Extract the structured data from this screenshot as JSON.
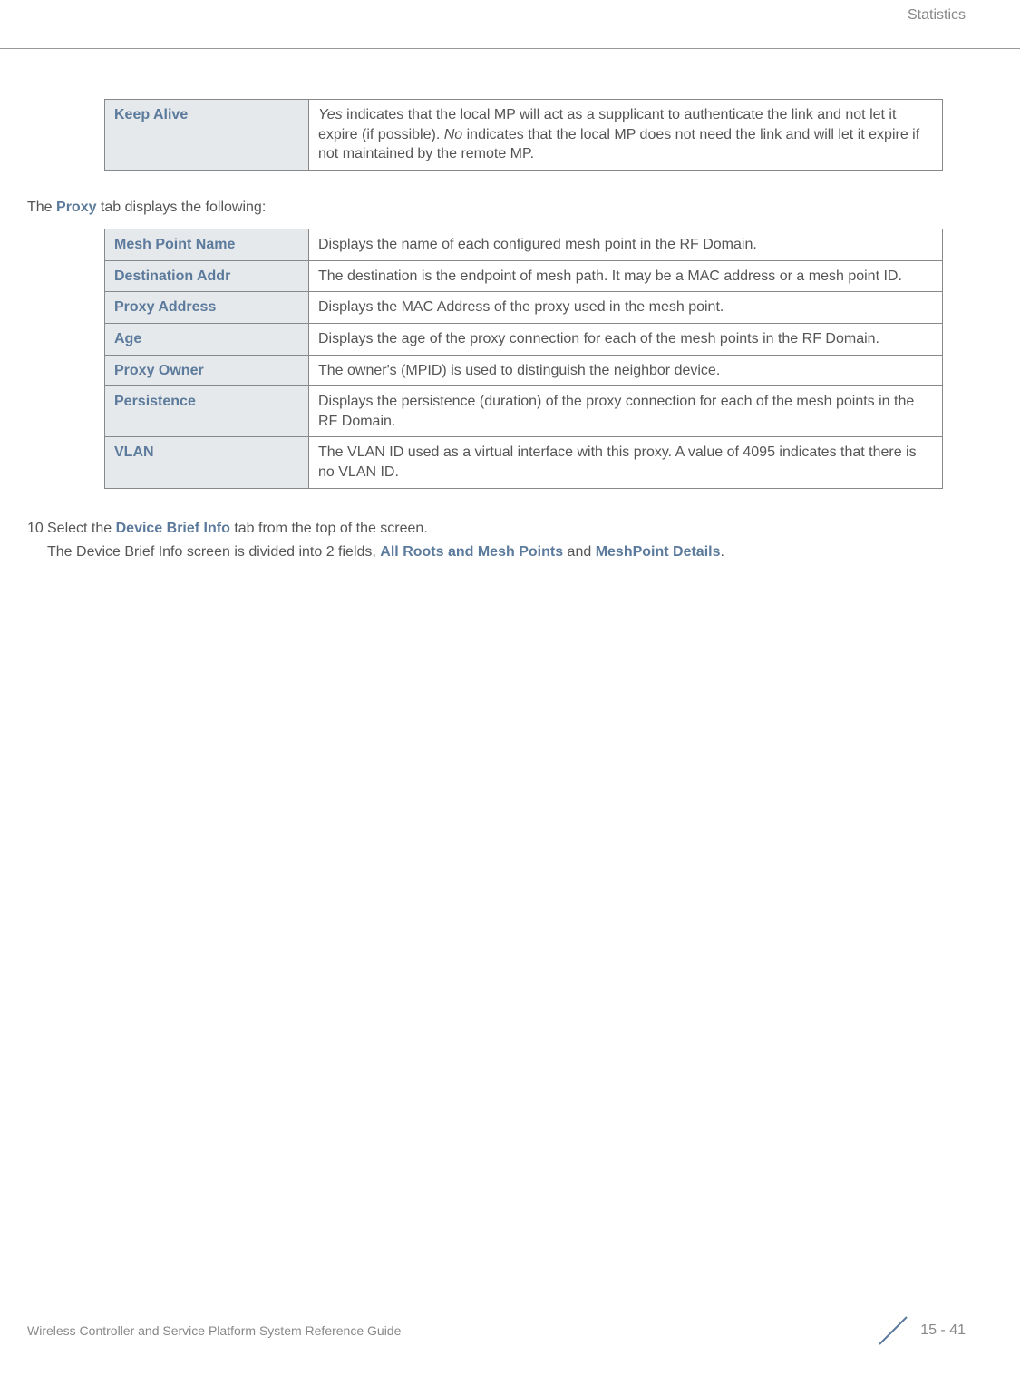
{
  "header": {
    "section": "Statistics"
  },
  "table1": {
    "rows": [
      {
        "label": "Keep Alive",
        "desc_prefix_italic": "Yes",
        "desc_part1": " indicates that the local MP will act as a supplicant to authenticate the link and not let it expire (if possible). ",
        "desc_mid_italic": "No",
        "desc_part2": " indicates that the local MP does not need the link and will let it expire if not maintained by the remote MP."
      }
    ]
  },
  "intro1": {
    "prefix": "The ",
    "bold": "Proxy",
    "suffix": " tab displays the following:"
  },
  "table2": {
    "rows": [
      {
        "label": "Mesh Point Name",
        "desc": "Displays the name of each configured mesh point in the RF Domain."
      },
      {
        "label": "Destination Addr",
        "desc": "The destination is the endpoint of mesh path. It may be a MAC address or a mesh point ID."
      },
      {
        "label": "Proxy Address",
        "desc": "Displays the MAC Address of the proxy used in the mesh point."
      },
      {
        "label": "Age",
        "desc": "Displays the age of the proxy connection for each of the mesh points in the RF Domain."
      },
      {
        "label": "Proxy Owner",
        "desc": "The owner's (MPID) is used to distinguish the neighbor device."
      },
      {
        "label": "Persistence",
        "desc": "Displays the persistence (duration) of the proxy connection for each of the mesh points in the RF Domain."
      },
      {
        "label": "VLAN",
        "desc": "The VLAN ID used as a virtual interface with this proxy. A value of 4095 indicates that there is no VLAN ID."
      }
    ]
  },
  "step": {
    "num": "10",
    "prefix": "Select the ",
    "bold": "Device Brief Info",
    "suffix": " tab from the top of the screen.",
    "line2_prefix": "The Device Brief Info screen is divided into 2 fields, ",
    "line2_bold1": "All Roots and Mesh Points",
    "line2_mid": " and ",
    "line2_bold2": "MeshPoint Details",
    "line2_suffix": "."
  },
  "footer": {
    "left": "Wireless Controller and Service Platform System Reference Guide",
    "page": "15 - 41"
  }
}
